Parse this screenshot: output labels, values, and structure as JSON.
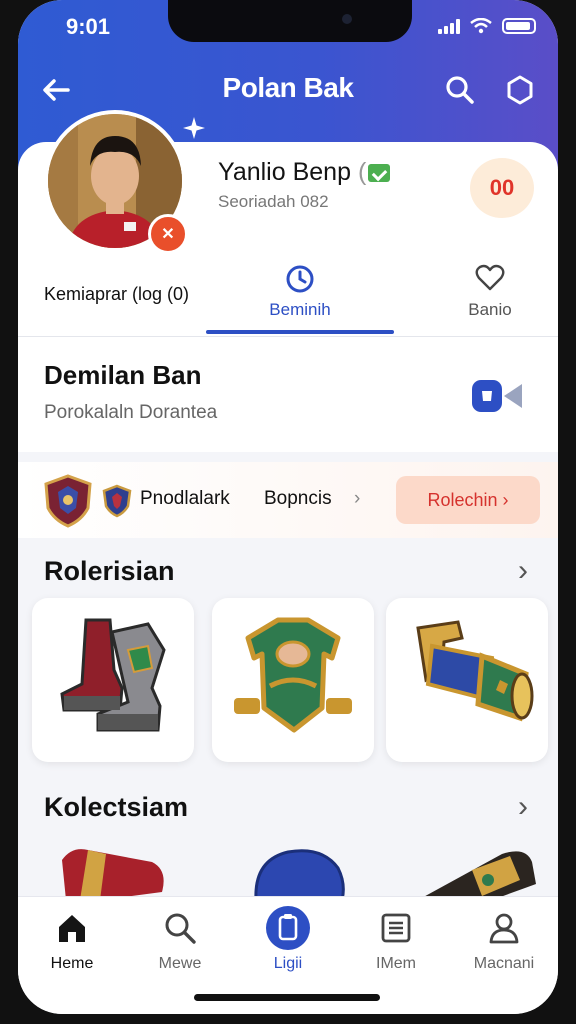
{
  "status": {
    "time": "9:01"
  },
  "nav": {
    "title": "Polan Bak"
  },
  "profile": {
    "name": "Yanlio Benp",
    "subtitle": "Seoriadah 082",
    "score_badge": "00"
  },
  "tabs": {
    "left_label": "Kemiaprar (log (0)",
    "items": [
      {
        "label": "Beminih",
        "icon": "clock-icon",
        "active": true
      },
      {
        "label": "Banio",
        "icon": "heart-icon",
        "active": false
      }
    ]
  },
  "section_header": {
    "title": "Demilan Ban",
    "subtitle": "Porokalaln Dorantea",
    "icon": "camera-badge-icon"
  },
  "promo": {
    "label_a": "Pnodlalark",
    "label_b": "Bopncis",
    "chevron": "›",
    "button": "Rolechin ›"
  },
  "section1": {
    "title": "Rolerisian",
    "chevron": "›"
  },
  "section2": {
    "title": "Kolectsiam",
    "chevron": "›"
  },
  "bottom_nav": [
    {
      "label": "Heme",
      "icon": "home-icon"
    },
    {
      "label": "Mewe",
      "icon": "search-icon"
    },
    {
      "label": "Ligii",
      "icon": "clipboard-icon"
    },
    {
      "label": "IMem",
      "icon": "list-icon"
    },
    {
      "label": "Macnani",
      "icon": "user-icon"
    }
  ],
  "colors": {
    "accent": "#2d4fc4",
    "header_start": "#2f5bd3",
    "header_end": "#5a4ec8",
    "promo_button": "#fcd9c9"
  }
}
